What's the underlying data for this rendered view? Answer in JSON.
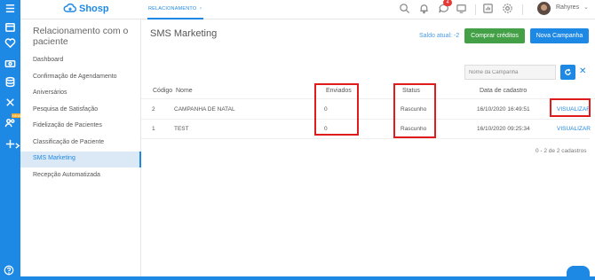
{
  "topbar": {
    "logo_text": "Shosp",
    "active_tab": "RELACIONAMENTO",
    "notification_count": "4",
    "username": "Rahyres"
  },
  "sidebar": {
    "title": "Relacionamento com o paciente",
    "items": [
      {
        "label": "Dashboard"
      },
      {
        "label": "Confirmação de Agendamento"
      },
      {
        "label": "Aniversários"
      },
      {
        "label": "Pesquisa de Satisfação"
      },
      {
        "label": "Fidelização de Pacientes"
      },
      {
        "label": "Classificação de Paciente"
      },
      {
        "label": "SMS Marketing"
      },
      {
        "label": "Recepção Automatizada"
      }
    ],
    "active_item": "SMS Marketing"
  },
  "main": {
    "title": "SMS Marketing",
    "saldo": "Saldo atual: -2",
    "buy_credits_label": "Comprar créditos",
    "new_campaign_label": "Nova Campanha",
    "search_placeholder": "Nome da Campanha",
    "table": {
      "headers": {
        "codigo": "Código",
        "nome": "Nome",
        "enviados": "Enviados",
        "status": "Status",
        "data": "Data de cadastro"
      },
      "rows": [
        {
          "codigo": "2",
          "nome": "CAMPANHA DE NATAL",
          "enviados": "0",
          "status": "Rascunho",
          "data": "16/10/2020 16:49:51",
          "action": "VISUALIZAR"
        },
        {
          "codigo": "1",
          "nome": "TEST",
          "enviados": "0",
          "status": "Rascunho",
          "data": "16/10/2020 09:25:34",
          "action": "VISUALIZAR"
        }
      ]
    },
    "pagination": "0 - 2 de 2 cadastros"
  },
  "colors": {
    "primary": "#1e88e5",
    "success": "#43a047",
    "highlight": "#e01b1b"
  }
}
